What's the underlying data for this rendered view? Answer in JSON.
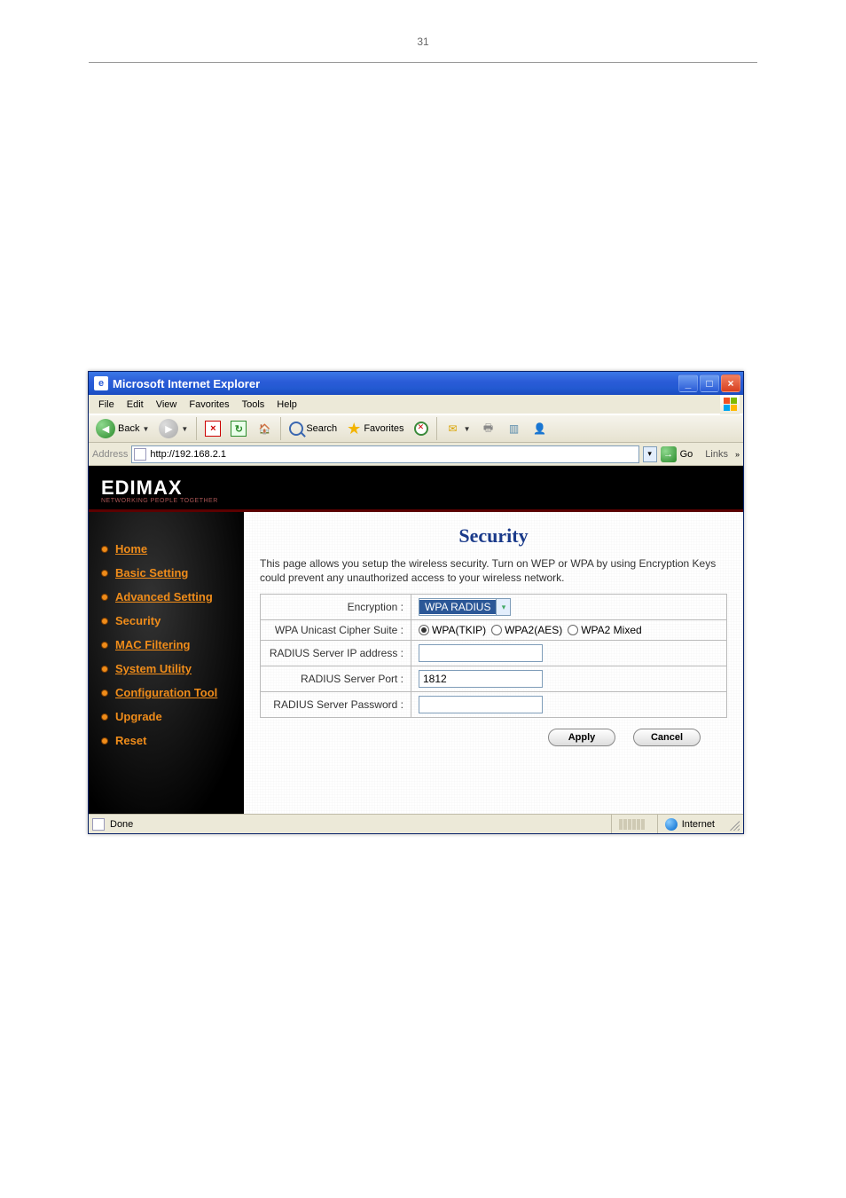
{
  "page_number": "31",
  "window": {
    "title": "Microsoft Internet Explorer",
    "menus": [
      "File",
      "Edit",
      "View",
      "Favorites",
      "Tools",
      "Help"
    ],
    "toolbar": {
      "back": "Back",
      "search": "Search",
      "favorites": "Favorites"
    },
    "address_label": "Address",
    "url": "http://192.168.2.1",
    "go_label": "Go",
    "links_label": "Links"
  },
  "brand": {
    "name": "EDIMAX",
    "tag": "NETWORKING PEOPLE TOGETHER"
  },
  "nav": {
    "items": [
      {
        "label": "Home",
        "underline": true
      },
      {
        "label": "Basic Setting",
        "underline": true
      },
      {
        "label": "Advanced Setting",
        "underline": true
      },
      {
        "label": "Security",
        "underline": false
      },
      {
        "label": "MAC Filtering",
        "underline": true
      },
      {
        "label": "System Utility",
        "underline": true
      },
      {
        "label": "Configuration Tool",
        "underline": true
      },
      {
        "label": "Upgrade",
        "underline": false
      },
      {
        "label": "Reset",
        "underline": false
      }
    ]
  },
  "main": {
    "title": "Security",
    "desc": "This page allows you setup the wireless security. Turn on WEP or WPA by using Encryption Keys could prevent any unauthorized access to your wireless network.",
    "rows": {
      "encryption_label": "Encryption :",
      "encryption_value": "WPA RADIUS",
      "cipher_label": "WPA Unicast Cipher Suite :",
      "cipher_options": [
        "WPA(TKIP)",
        "WPA2(AES)",
        "WPA2 Mixed"
      ],
      "cipher_selected": "WPA(TKIP)",
      "radius_ip_label": "RADIUS Server IP address :",
      "radius_ip_value": "",
      "radius_port_label": "RADIUS Server Port :",
      "radius_port_value": "1812",
      "radius_pw_label": "RADIUS Server Password :",
      "radius_pw_value": ""
    },
    "buttons": {
      "apply": "Apply",
      "cancel": "Cancel"
    }
  },
  "status": {
    "text": "Done",
    "zone": "Internet"
  }
}
